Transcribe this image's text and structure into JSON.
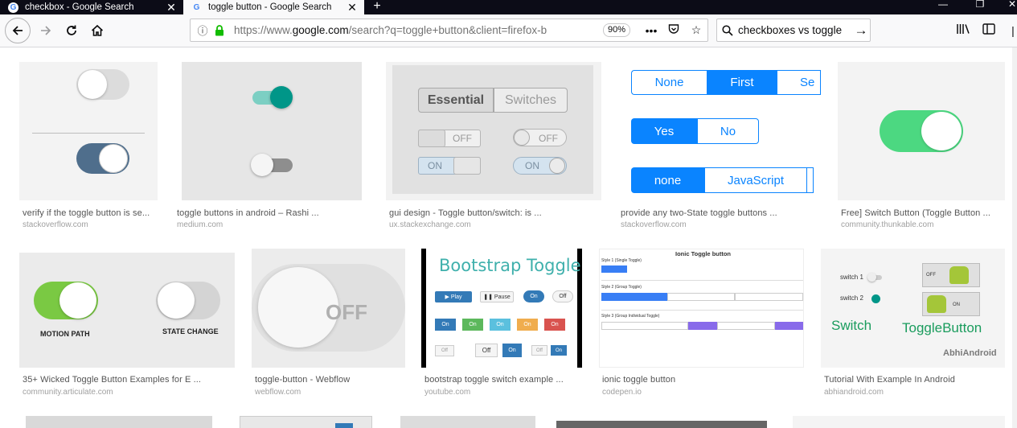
{
  "tabs": [
    {
      "title": "checkbox - Google Search",
      "active": false
    },
    {
      "title": "toggle button - Google Search",
      "active": true
    }
  ],
  "nav": {
    "url_prefix": "https://www.",
    "url_domain": "google.com",
    "url_rest": "/search?q=toggle+button&client=firefox-b",
    "zoom": "90%",
    "search_text": "checkboxes vs toggle"
  },
  "colors": {
    "accent_blue": "#0a84ff",
    "tab_bg": "#0c0c17",
    "lock_green": "#12bc00"
  },
  "results": [
    {
      "title": "verify if the toggle button is se...",
      "source": "stackoverflow.com"
    },
    {
      "title": "toggle buttons in android – Rashi ...",
      "source": "medium.com"
    },
    {
      "title": "gui design - Toggle button/switch: is ...",
      "source": "ux.stackexchange.com"
    },
    {
      "title": "provide any two-State toggle buttons ...",
      "source": "stackoverflow.com"
    },
    {
      "title": "Free] Switch Button (Toggle Button ...",
      "source": "community.thunkable.com"
    },
    {
      "title": "35+ Wicked Toggle Button Examples for E ...",
      "source": "community.articulate.com"
    },
    {
      "title": "toggle-button - Webflow",
      "source": "webflow.com"
    },
    {
      "title": "bootstrap toggle switch example ...",
      "source": "youtube.com"
    },
    {
      "title": "ionic toggle button",
      "source": "codepen.io"
    },
    {
      "title": "Tutorial With Example In Android",
      "source": "abhiandroid.com"
    }
  ],
  "thumb_text": {
    "ux_essential": "Essential",
    "ux_switches": "Switches",
    "ux_off": "OFF",
    "ux_on": "ON",
    "so_none": "None",
    "so_first": "First",
    "so_se": "Se",
    "so_yes": "Yes",
    "so_no": "No",
    "so_none_lower": "none",
    "so_javascript": "JavaScript",
    "art_motion": "MOTION PATH",
    "art_state": "STATE CHANGE",
    "wf_off": "OFF",
    "bs_title": "Bootstrap Toggle",
    "bs_play": "▶ Play",
    "bs_pause": "❚❚ Pause",
    "bs_on": "On",
    "bs_off": "Off",
    "ionic_title": "Ionic Toggle button",
    "ionic_s1": "Style 1 (Single Toggle)",
    "ionic_s2": "Style 2 (Group Toggle)",
    "ionic_s3": "Style 3 (Group Individual Toggle)",
    "abhi_switch1": "switch 1",
    "abhi_switch2": "switch 2",
    "abhi_off": "OFF",
    "abhi_on": "ON",
    "abhi_switch": "Switch",
    "abhi_togglebutton": "ToggleButton",
    "abhi_brand": "AbhiAndroid"
  }
}
